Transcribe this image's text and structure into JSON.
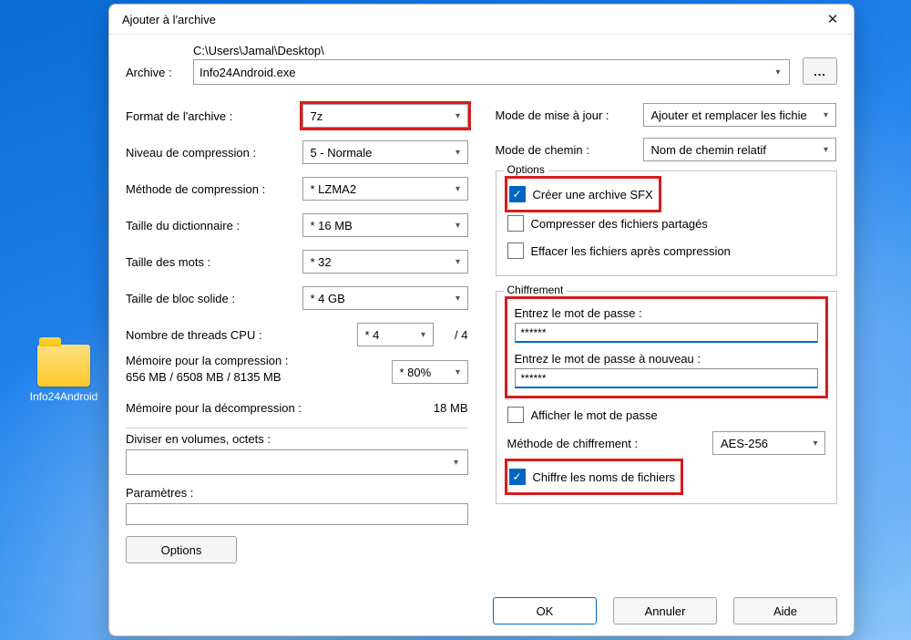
{
  "desktop": {
    "folder_label": "Info24Android"
  },
  "dialog": {
    "title": "Ajouter à l'archive",
    "archive_label": "Archive :",
    "archive_path": "C:\\Users\\Jamal\\Desktop\\",
    "archive_filename": "Info24Android.exe",
    "browse_label": "...",
    "left": {
      "format_label": "Format de l'archive :",
      "format_value": "7z",
      "level_label": "Niveau de compression :",
      "level_value": "5 - Normale",
      "method_label": "Méthode de compression :",
      "method_value": "* LZMA2",
      "dict_label": "Taille du dictionnaire :",
      "dict_value": "* 16 MB",
      "word_label": "Taille des mots :",
      "word_value": "* 32",
      "block_label": "Taille de bloc solide :",
      "block_value": "* 4 GB",
      "threads_label": "Nombre de threads CPU :",
      "threads_value": "* 4",
      "threads_max": "/ 4",
      "mem_compress_label": "Mémoire pour la compression :",
      "mem_compress_info": "656 MB / 6508 MB / 8135 MB",
      "mem_percent": "* 80%",
      "mem_decompress_label": "Mémoire pour la décompression :",
      "mem_decompress_value": "18 MB",
      "split_label": "Diviser en volumes, octets :",
      "params_label": "Paramètres :",
      "options_button": "Options"
    },
    "right": {
      "update_mode_label": "Mode de mise à jour :",
      "update_mode_value": "Ajouter et remplacer les fichie",
      "path_mode_label": "Mode de chemin :",
      "path_mode_value": "Nom de chemin relatif",
      "options_legend": "Options",
      "sfx_label": "Créer une archive SFX",
      "shared_label": "Compresser des fichiers partagés",
      "delete_label": "Effacer les fichiers après compression",
      "encrypt_legend": "Chiffrement",
      "pwd1_label": "Entrez le mot de passe :",
      "pwd1_value": "******",
      "pwd2_label": "Entrez le mot de passe à nouveau :",
      "pwd2_value": "******",
      "show_pwd_label": "Afficher le mot de passe",
      "enc_method_label": "Méthode de chiffrement :",
      "enc_method_value": "AES-256",
      "enc_names_label": "Chiffre les noms de fichiers"
    },
    "buttons": {
      "ok": "OK",
      "cancel": "Annuler",
      "help": "Aide"
    }
  }
}
